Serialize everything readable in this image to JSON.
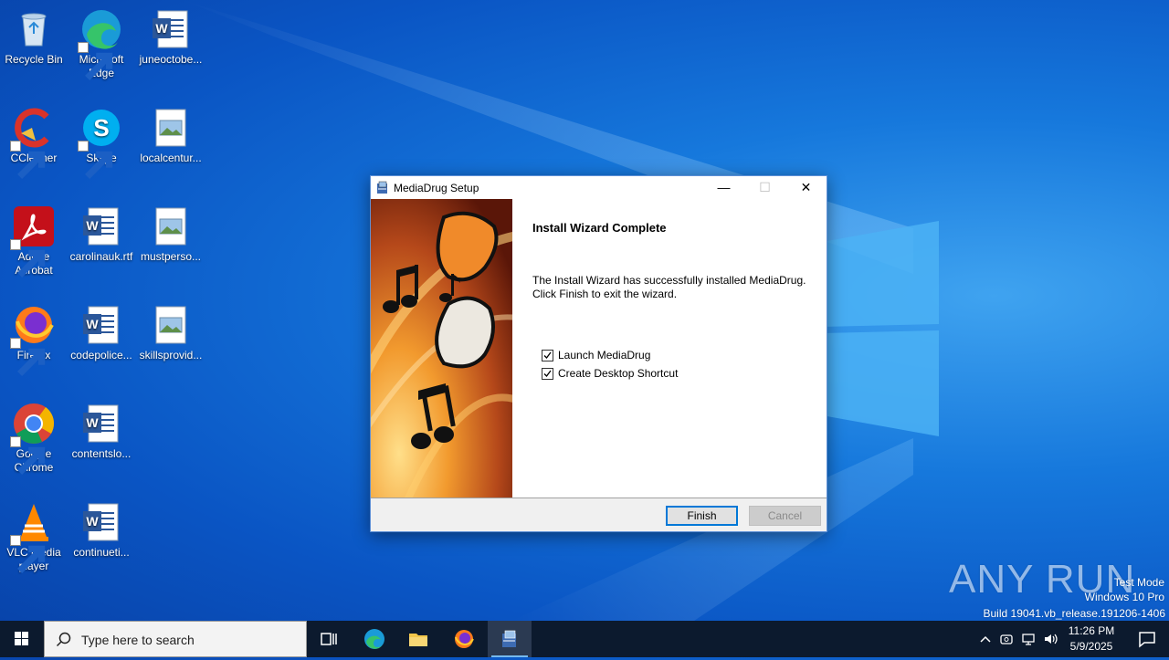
{
  "desktop": {
    "icons": [
      {
        "label": "Recycle Bin"
      },
      {
        "label": "Microsoft Edge"
      },
      {
        "label": "juneoctobe..."
      },
      {
        "label": "CCleaner"
      },
      {
        "label": "Skype"
      },
      {
        "label": "localcentur..."
      },
      {
        "label": "Adobe Acrobat"
      },
      {
        "label": "carolinauk.rtf"
      },
      {
        "label": "mustperso..."
      },
      {
        "label": "Firefox"
      },
      {
        "label": "codepolice..."
      },
      {
        "label": "skillsprovid..."
      },
      {
        "label": "Google Chrome"
      },
      {
        "label": "contentslo..."
      },
      {
        "label": "VLC media player"
      },
      {
        "label": "continueti..."
      }
    ]
  },
  "dialog": {
    "title": "MediaDrug Setup",
    "minimize": "—",
    "maximize": "☐",
    "close": "✕",
    "heading": "Install Wizard Complete",
    "desc_line1": "The Install Wizard has successfully installed MediaDrug.",
    "desc_line2": "Click Finish to exit the wizard.",
    "options": [
      {
        "label": "Launch MediaDrug",
        "checked": true
      },
      {
        "label": "Create Desktop Shortcut",
        "checked": true
      }
    ],
    "finish_label": "Finish",
    "cancel_label": "Cancel"
  },
  "taskbar": {
    "search_placeholder": "Type here to search",
    "time": "11:26 PM",
    "date": "5/9/2025"
  },
  "watermark": {
    "brand": "ANY RUN",
    "line1": "Test Mode",
    "line2": "Windows 10 Pro",
    "line3": "Build 19041.vb_release.191206-1406"
  },
  "colors": {
    "accent": "#0078d7",
    "taskbar": "#0c1a2e"
  }
}
